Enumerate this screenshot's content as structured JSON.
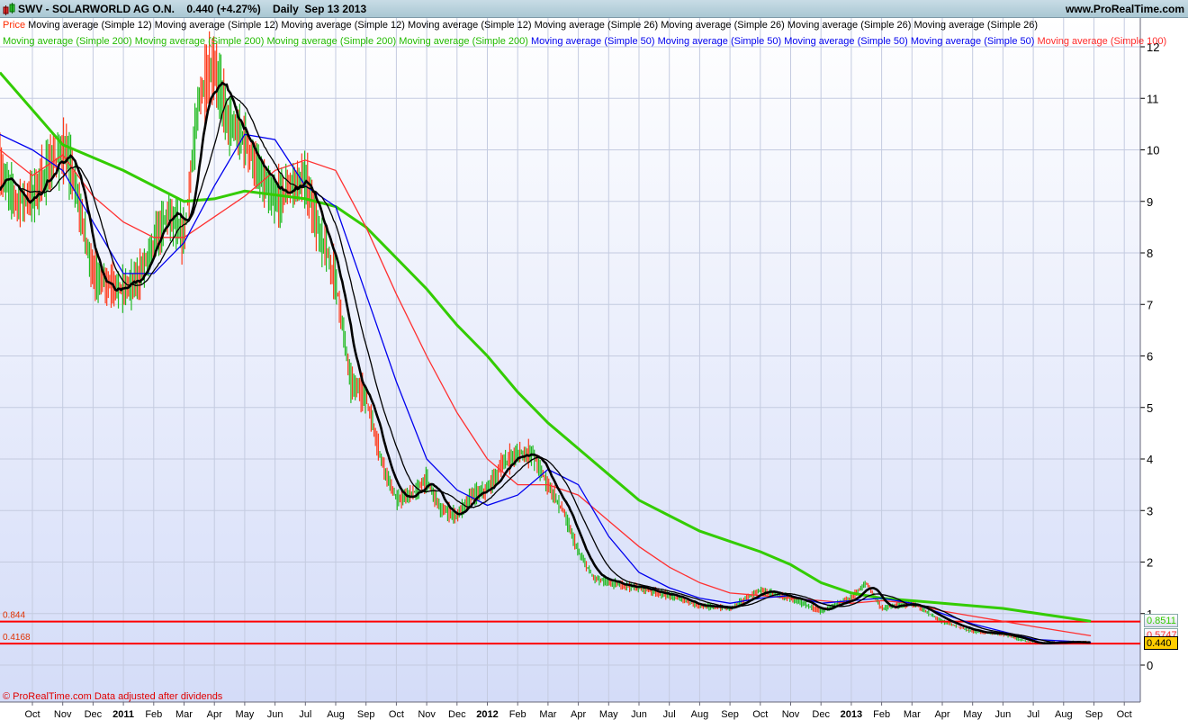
{
  "header": {
    "title": "SWV - SOLARWORLD AG O.N.    0.440 (+4.27%)    Daily  Sep 13 2013",
    "website": "www.ProRealTime.com"
  },
  "legend": {
    "line1": [
      {
        "text": "Price",
        "color": "#ff2a00"
      },
      {
        "text": "Moving average (Simple 12)",
        "color": "#000000"
      },
      {
        "text": "Moving average (Simple 12)",
        "color": "#000000"
      },
      {
        "text": "Moving average (Simple 12)",
        "color": "#000000"
      },
      {
        "text": "Moving average (Simple 12)",
        "color": "#000000"
      },
      {
        "text": "Moving average (Simple 26)",
        "color": "#000000"
      },
      {
        "text": "Moving average (Simple 26)",
        "color": "#000000"
      },
      {
        "text": "Moving average (Simple 26)",
        "color": "#000000"
      },
      {
        "text": "Moving average (Simple 26)",
        "color": "#000000"
      }
    ],
    "line2": [
      {
        "text": "Moving average (Simple 200)",
        "color": "#22bb00"
      },
      {
        "text": "Moving average (Simple 200)",
        "color": "#22bb00"
      },
      {
        "text": "Moving average (Simple 200)",
        "color": "#22bb00"
      },
      {
        "text": "Moving average (Simple 200)",
        "color": "#22bb00"
      },
      {
        "text": "Moving average (Simple 50)",
        "color": "#0000ee"
      },
      {
        "text": "Moving average (Simple 50)",
        "color": "#0000ee"
      },
      {
        "text": "Moving average (Simple 50)",
        "color": "#0000ee"
      },
      {
        "text": "Moving average (Simple 50)",
        "color": "#0000ee"
      },
      {
        "text": "Moving average (Simple 100)",
        "color": "#ff2a2a"
      }
    ]
  },
  "footer": "© ProRealTime.com  Data adjusted after dividends",
  "chart_data": {
    "type": "line",
    "title": "SWV - SOLARWORLD AG O.N. Daily",
    "x_unit": "months since Oct 2010",
    "xlim": [
      -1.07,
      36.5
    ],
    "ylim": [
      -0.72,
      12.3
    ],
    "y_ticks": [
      0,
      1,
      2,
      3,
      4,
      5,
      6,
      7,
      8,
      9,
      10,
      11,
      12
    ],
    "x_ticks": [
      {
        "m": 0,
        "label": "Oct"
      },
      {
        "m": 1,
        "label": "Nov"
      },
      {
        "m": 2,
        "label": "Dec"
      },
      {
        "m": 3,
        "label": "2011",
        "bold": true
      },
      {
        "m": 4,
        "label": "Feb"
      },
      {
        "m": 5,
        "label": "Mar"
      },
      {
        "m": 6,
        "label": "Apr"
      },
      {
        "m": 7,
        "label": "May"
      },
      {
        "m": 8,
        "label": "Jun"
      },
      {
        "m": 9,
        "label": "Jul"
      },
      {
        "m": 10,
        "label": "Aug"
      },
      {
        "m": 11,
        "label": "Sep"
      },
      {
        "m": 12,
        "label": "Oct"
      },
      {
        "m": 13,
        "label": "Nov"
      },
      {
        "m": 14,
        "label": "Dec"
      },
      {
        "m": 15,
        "label": "2012",
        "bold": true
      },
      {
        "m": 16,
        "label": "Feb"
      },
      {
        "m": 17,
        "label": "Mar"
      },
      {
        "m": 18,
        "label": "Apr"
      },
      {
        "m": 19,
        "label": "May"
      },
      {
        "m": 20,
        "label": "Jun"
      },
      {
        "m": 21,
        "label": "Jul"
      },
      {
        "m": 22,
        "label": "Aug"
      },
      {
        "m": 23,
        "label": "Sep"
      },
      {
        "m": 24,
        "label": "Oct"
      },
      {
        "m": 25,
        "label": "Nov"
      },
      {
        "m": 26,
        "label": "Dec"
      },
      {
        "m": 27,
        "label": "2013",
        "bold": true
      },
      {
        "m": 28,
        "label": "Feb"
      },
      {
        "m": 29,
        "label": "Mar"
      },
      {
        "m": 30,
        "label": "Apr"
      },
      {
        "m": 31,
        "label": "May"
      },
      {
        "m": 32,
        "label": "Jun"
      },
      {
        "m": 33,
        "label": "Jul"
      },
      {
        "m": 34,
        "label": "Aug"
      },
      {
        "m": 35,
        "label": "Sep"
      },
      {
        "m": 36,
        "label": "Oct"
      }
    ],
    "price": [
      [
        -1.07,
        9.6
      ],
      [
        -0.5,
        9.0
      ],
      [
        0,
        9.1
      ],
      [
        0.5,
        9.6
      ],
      [
        1,
        10.0
      ],
      [
        1.3,
        9.6
      ],
      [
        2,
        7.6
      ],
      [
        2.5,
        7.4
      ],
      [
        3,
        7.3
      ],
      [
        3.5,
        7.5
      ],
      [
        4,
        8.2
      ],
      [
        4.5,
        8.8
      ],
      [
        5,
        8.3
      ],
      [
        5.5,
        11.0
      ],
      [
        6,
        11.6
      ],
      [
        6.5,
        10.5
      ],
      [
        7,
        10.2
      ],
      [
        7.5,
        9.5
      ],
      [
        8,
        9.0
      ],
      [
        8.5,
        9.3
      ],
      [
        9,
        9.4
      ],
      [
        9.5,
        8.3
      ],
      [
        10,
        7.5
      ],
      [
        10.5,
        5.5
      ],
      [
        11,
        5.2
      ],
      [
        11.5,
        4.0
      ],
      [
        12,
        3.2
      ],
      [
        12.5,
        3.3
      ],
      [
        13,
        3.6
      ],
      [
        13.5,
        3.0
      ],
      [
        14,
        2.9
      ],
      [
        14.5,
        3.3
      ],
      [
        15,
        3.4
      ],
      [
        15.5,
        3.9
      ],
      [
        16,
        4.1
      ],
      [
        16.5,
        4.1
      ],
      [
        17,
        3.5
      ],
      [
        17.5,
        3.0
      ],
      [
        18,
        2.2
      ],
      [
        18.5,
        1.7
      ],
      [
        19,
        1.6
      ],
      [
        20,
        1.5
      ],
      [
        21,
        1.35
      ],
      [
        22,
        1.15
      ],
      [
        23,
        1.1
      ],
      [
        24,
        1.45
      ],
      [
        25,
        1.3
      ],
      [
        26,
        1.05
      ],
      [
        27,
        1.3
      ],
      [
        27.5,
        1.6
      ],
      [
        28,
        1.1
      ],
      [
        29,
        1.2
      ],
      [
        30,
        0.85
      ],
      [
        31,
        0.65
      ],
      [
        32,
        0.6
      ],
      [
        33,
        0.42
      ],
      [
        34,
        0.45
      ],
      [
        34.9,
        0.44
      ]
    ],
    "series": [
      {
        "name": "Moving average (Simple 200)",
        "color": "#33cc00",
        "points": [
          [
            -1.07,
            11.5
          ],
          [
            1,
            10.1
          ],
          [
            3,
            9.6
          ],
          [
            5,
            9.0
          ],
          [
            6,
            9.05
          ],
          [
            7,
            9.2
          ],
          [
            9,
            9.05
          ],
          [
            10,
            8.9
          ],
          [
            11,
            8.5
          ],
          [
            12,
            7.9
          ],
          [
            13,
            7.3
          ],
          [
            14,
            6.6
          ],
          [
            15,
            6.0
          ],
          [
            16,
            5.3
          ],
          [
            17,
            4.7
          ],
          [
            18,
            4.2
          ],
          [
            19,
            3.7
          ],
          [
            20,
            3.2
          ],
          [
            21,
            2.9
          ],
          [
            22,
            2.6
          ],
          [
            23,
            2.4
          ],
          [
            24,
            2.2
          ],
          [
            25,
            1.95
          ],
          [
            26,
            1.6
          ],
          [
            27,
            1.4
          ],
          [
            28,
            1.3
          ],
          [
            30,
            1.2
          ],
          [
            32,
            1.1
          ],
          [
            34.9,
            0.85
          ]
        ]
      },
      {
        "name": "Moving average (Simple 100)",
        "color": "#ff3030",
        "points": [
          [
            -1.07,
            10.0
          ],
          [
            0,
            9.5
          ],
          [
            1,
            9.9
          ],
          [
            2,
            9.1
          ],
          [
            3,
            8.6
          ],
          [
            4,
            8.3
          ],
          [
            5,
            8.3
          ],
          [
            6,
            8.7
          ],
          [
            7,
            9.1
          ],
          [
            8,
            9.6
          ],
          [
            9,
            9.8
          ],
          [
            10,
            9.6
          ],
          [
            11,
            8.5
          ],
          [
            12,
            7.2
          ],
          [
            13,
            6.0
          ],
          [
            14,
            4.9
          ],
          [
            15,
            4.0
          ],
          [
            16,
            3.5
          ],
          [
            17,
            3.5
          ],
          [
            18,
            3.3
          ],
          [
            19,
            2.8
          ],
          [
            20,
            2.3
          ],
          [
            21,
            1.9
          ],
          [
            22,
            1.6
          ],
          [
            23,
            1.4
          ],
          [
            24,
            1.35
          ],
          [
            25,
            1.3
          ],
          [
            26,
            1.25
          ],
          [
            27,
            1.2
          ],
          [
            28,
            1.25
          ],
          [
            29,
            1.2
          ],
          [
            30,
            1.05
          ],
          [
            31,
            0.95
          ],
          [
            32,
            0.85
          ],
          [
            33,
            0.75
          ],
          [
            34.9,
            0.57
          ]
        ]
      },
      {
        "name": "Moving average (Simple 50)",
        "color": "#0000ee",
        "points": [
          [
            -1.07,
            10.3
          ],
          [
            0,
            10.0
          ],
          [
            1,
            9.6
          ],
          [
            2,
            8.6
          ],
          [
            3,
            7.6
          ],
          [
            4,
            7.6
          ],
          [
            5,
            8.2
          ],
          [
            6,
            9.3
          ],
          [
            7,
            10.3
          ],
          [
            8,
            10.2
          ],
          [
            9,
            9.3
          ],
          [
            10,
            8.9
          ],
          [
            11,
            7.2
          ],
          [
            12,
            5.5
          ],
          [
            13,
            4.0
          ],
          [
            14,
            3.4
          ],
          [
            15,
            3.1
          ],
          [
            16,
            3.3
          ],
          [
            17,
            3.8
          ],
          [
            18,
            3.5
          ],
          [
            19,
            2.5
          ],
          [
            20,
            1.8
          ],
          [
            21,
            1.5
          ],
          [
            22,
            1.3
          ],
          [
            23,
            1.2
          ],
          [
            24,
            1.3
          ],
          [
            25,
            1.35
          ],
          [
            26,
            1.2
          ],
          [
            27,
            1.25
          ],
          [
            28,
            1.3
          ],
          [
            29,
            1.2
          ],
          [
            30,
            1.0
          ],
          [
            31,
            0.8
          ],
          [
            32,
            0.65
          ],
          [
            33,
            0.5
          ],
          [
            34.9,
            0.44
          ]
        ]
      }
    ],
    "hlines": [
      {
        "value": 0.844,
        "label": "0.844"
      },
      {
        "value": 0.4168,
        "label": "0.4168"
      }
    ],
    "last_values": [
      {
        "value": "0.8511",
        "color": "#33cc00"
      },
      {
        "value": "0.5747",
        "color": "#ff3030"
      },
      {
        "value": "0.440",
        "color": "#000000",
        "bg": "#ffcc00"
      }
    ]
  }
}
